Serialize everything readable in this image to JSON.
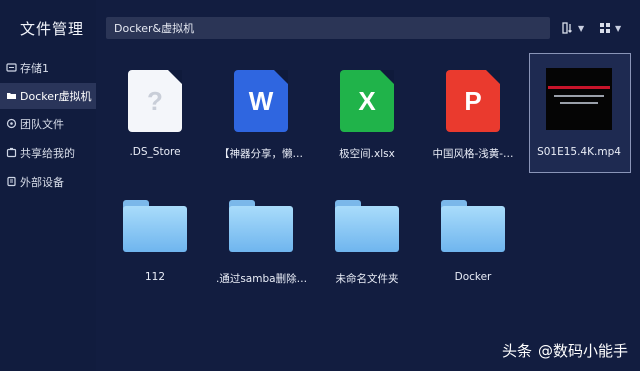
{
  "app": {
    "title": "文件管理"
  },
  "sidebar": {
    "items": [
      {
        "label": "存储1",
        "icon": "storage-icon"
      },
      {
        "label": "Docker虚拟机",
        "icon": "folder-icon",
        "active": true
      },
      {
        "label": "团队文件",
        "icon": "team-icon"
      },
      {
        "label": "共享给我的",
        "icon": "share-icon"
      },
      {
        "label": "外部设备",
        "icon": "device-icon"
      }
    ]
  },
  "path": {
    "current": "Docker&虚拟机"
  },
  "toolbar": {
    "sort_icon": "sort-icon",
    "view_icon": "grid-view-icon"
  },
  "files": [
    {
      "name": ".DS_Store",
      "type": "unknown",
      "glyph": "?",
      "color": "#f4f6fa"
    },
    {
      "name": "【神器分享，懒…",
      "type": "word",
      "glyph": "W",
      "color": "#2f66e0"
    },
    {
      "name": "极空间.xlsx",
      "type": "excel",
      "glyph": "X",
      "color": "#20b34a"
    },
    {
      "name": "中国风格-浅黄-…",
      "type": "ppt",
      "glyph": "P",
      "color": "#ea3a2e"
    },
    {
      "name": "S01E15.4K.mp4",
      "type": "video",
      "selected": true
    }
  ],
  "folders": [
    {
      "name": "112"
    },
    {
      "name": ".通过samba删除…"
    },
    {
      "name": "未命名文件夹"
    },
    {
      "name": "Docker"
    }
  ],
  "watermark": {
    "platform": "头条",
    "handle": "@数码小能手"
  }
}
